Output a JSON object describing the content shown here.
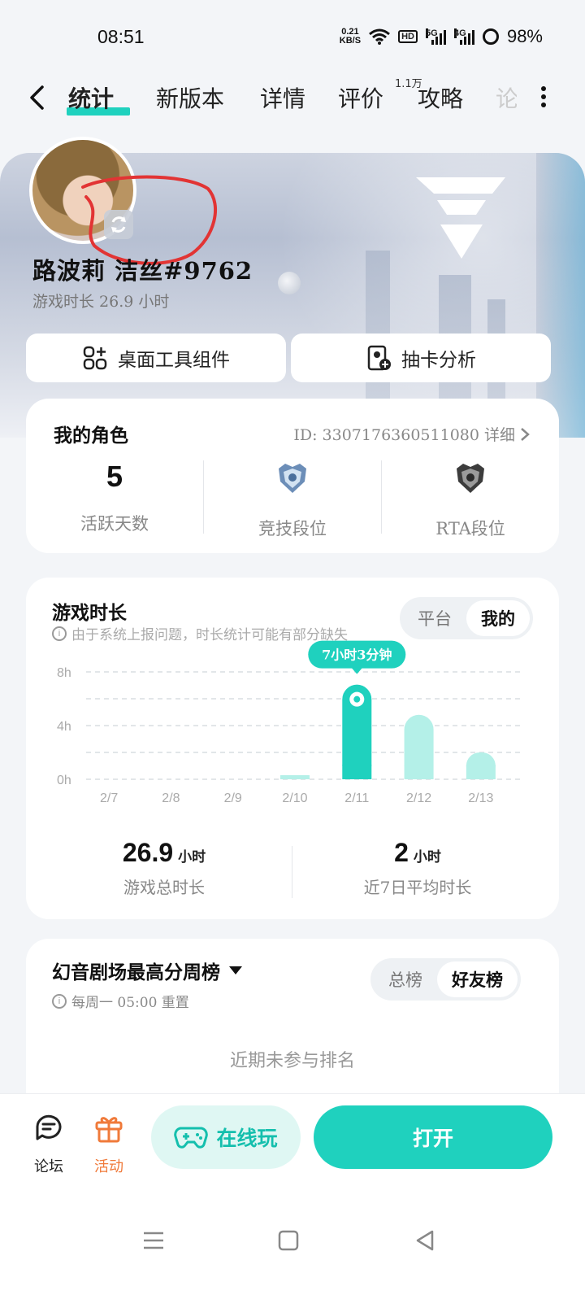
{
  "status": {
    "time": "08:51",
    "net_speed_value": "0.21",
    "net_speed_unit": "KB/S",
    "hd_label": "HD",
    "sig1_label": "5G",
    "sig2_label": "4G",
    "battery": "98%"
  },
  "tabs": [
    {
      "label": "统计",
      "active": true
    },
    {
      "label": "新版本"
    },
    {
      "label": "详情"
    },
    {
      "label": "评价",
      "badge": "1.1万"
    },
    {
      "label": "攻略"
    },
    {
      "label": "论"
    }
  ],
  "profile": {
    "name": "路波莉 洁丝#9762",
    "play_time": "游戏时长 26.9 小时"
  },
  "quick_actions": {
    "widget": "桌面工具组件",
    "gacha": "抽卡分析"
  },
  "role_card": {
    "title": "我的角色",
    "id_text": "ID: 3307176360511080 详细",
    "active_days_value": "5",
    "active_days_label": "活跃天数",
    "arena_label": "竞技段位",
    "rta_label": "RTA段位"
  },
  "playtime_card": {
    "title": "游戏时长",
    "notice": "由于系统上报问题，时长统计可能有部分缺失",
    "toggle_platform": "平台",
    "toggle_mine": "我的",
    "total_value": "26.9",
    "total_unit": "小时",
    "total_label": "游戏总时长",
    "avg_value": "2",
    "avg_unit": "小时",
    "avg_label": "近7日平均时长"
  },
  "chart_data": {
    "type": "bar",
    "categories": [
      "2/7",
      "2/8",
      "2/9",
      "2/10",
      "2/11",
      "2/12",
      "2/13"
    ],
    "values": [
      0,
      0,
      0,
      0.3,
      7.05,
      4.8,
      2.0
    ],
    "yticks": [
      "8h",
      "4h",
      "0h"
    ],
    "ylim": [
      0,
      8
    ],
    "highlight_index": 4,
    "highlight_label": "7小时3分钟",
    "grid": true,
    "colors": {
      "active": "#1fd1be",
      "inactive": "#b4f0e8",
      "grid": "#d9dde2"
    }
  },
  "leaderboard": {
    "title": "幻音剧场最高分周榜",
    "reset": "每周一 05:00 重置",
    "toggle_total": "总榜",
    "toggle_friends": "好友榜",
    "empty": "近期未参与排名"
  },
  "bottom_bar": {
    "forum": "论坛",
    "events": "活动",
    "online_play": "在线玩",
    "open": "打开"
  },
  "colors": {
    "accent": "#1fd1be",
    "events_accent": "#f07a3a"
  }
}
